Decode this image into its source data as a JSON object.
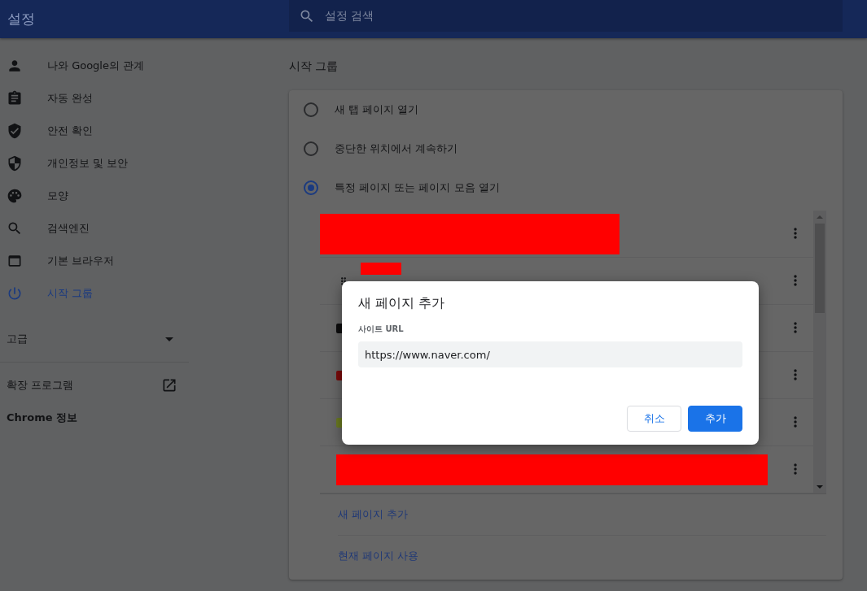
{
  "header": {
    "title": "설정",
    "search": {
      "placeholder": "설정 검색"
    }
  },
  "sidebar": {
    "items": [
      {
        "label": "나와 Google의 관계",
        "selected": false
      },
      {
        "label": "자동 완성",
        "selected": false
      },
      {
        "label": "안전 확인",
        "selected": false
      },
      {
        "label": "개인정보 및 보안",
        "selected": false
      },
      {
        "label": "모양",
        "selected": false
      },
      {
        "label": "검색엔진",
        "selected": false
      },
      {
        "label": "기본 브라우저",
        "selected": false
      },
      {
        "label": "시작 그룹",
        "selected": true
      }
    ],
    "advanced": {
      "label": "고급",
      "expanded": false
    },
    "extensions": {
      "label": "확장 프로그램"
    },
    "about": {
      "label": "Chrome 정보"
    }
  },
  "section": {
    "title": "시작 그룹",
    "options": [
      {
        "label": "새 탭 페이지 열기",
        "selected": false
      },
      {
        "label": "중단한 위치에서 계속하기",
        "selected": false
      },
      {
        "label": "특정 페이지 또는 페이지 모음 열기",
        "selected": true
      }
    ],
    "pages": [
      {
        "kind": "redacted-wide"
      },
      {
        "kind": "redacted-short"
      },
      {
        "kind": "favicon",
        "color": "#0d0d0e"
      },
      {
        "kind": "favicon",
        "color": "#7a0a0a"
      },
      {
        "kind": "favicon",
        "color": "#6a7a20"
      },
      {
        "kind": "redacted-wide"
      }
    ],
    "links": [
      "새 페이지 추가",
      "현재 페이지 사용"
    ]
  },
  "dialog": {
    "title": "새 페이지 추가",
    "field_label": "사이트 URL",
    "value": "https://www.naver.com/",
    "buttons": [
      {
        "label": "취소",
        "kind": "cancel"
      },
      {
        "label": "추가",
        "kind": "primary"
      }
    ]
  }
}
